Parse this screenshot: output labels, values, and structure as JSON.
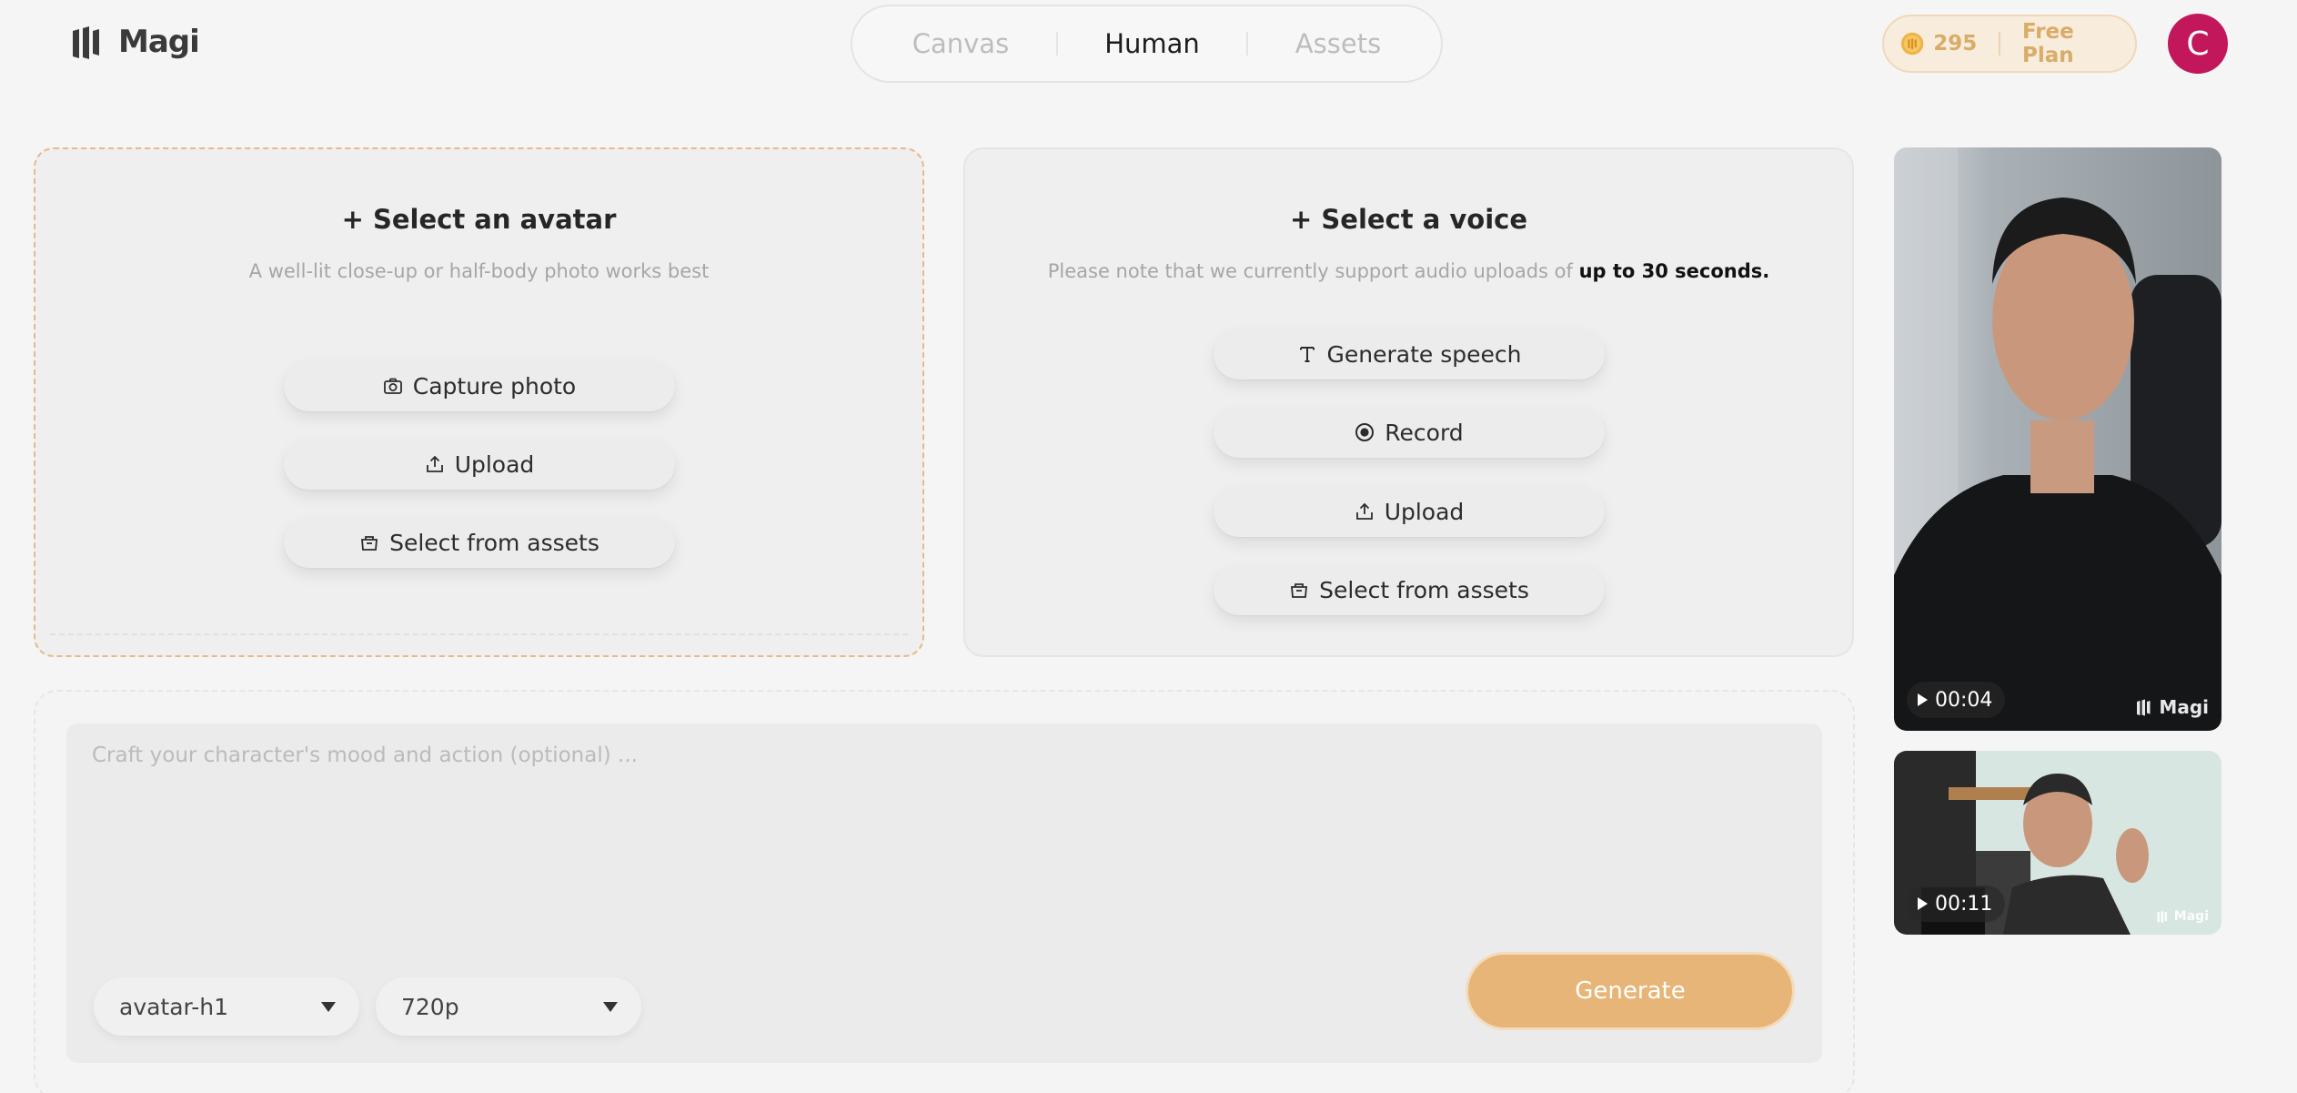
{
  "header": {
    "logo_text": "Magi",
    "tabs": [
      {
        "label": "Canvas"
      },
      {
        "label": "Human"
      },
      {
        "label": "Assets"
      }
    ],
    "credits": "295",
    "plan": "Free Plan",
    "user_initial": "C"
  },
  "avatar_card": {
    "title": "+ Select an avatar",
    "hint": "A well-lit close-up or half-body photo works best",
    "buttons": {
      "capture": "Capture photo",
      "upload": "Upload",
      "assets": "Select from assets"
    }
  },
  "voice_card": {
    "title": "+ Select a voice",
    "hint_prefix": "Please note that we currently support audio uploads of ",
    "hint_bold": "up to 30 seconds.",
    "buttons": {
      "speech": "Generate speech",
      "record": "Record",
      "upload": "Upload",
      "assets": "Select from assets"
    }
  },
  "prompt": {
    "placeholder": "Craft your character's mood and action (optional) ...",
    "value": "",
    "model": "avatar-h1",
    "resolution": "720p",
    "generate_label": "Generate"
  },
  "previews": [
    {
      "duration": "00:04",
      "watermark": "Magi"
    },
    {
      "duration": "00:11",
      "watermark": "Magi"
    }
  ],
  "colors": {
    "accent": "#e7b577",
    "avatar_bg": "#c2185b",
    "plan_text": "#d9ac68"
  }
}
